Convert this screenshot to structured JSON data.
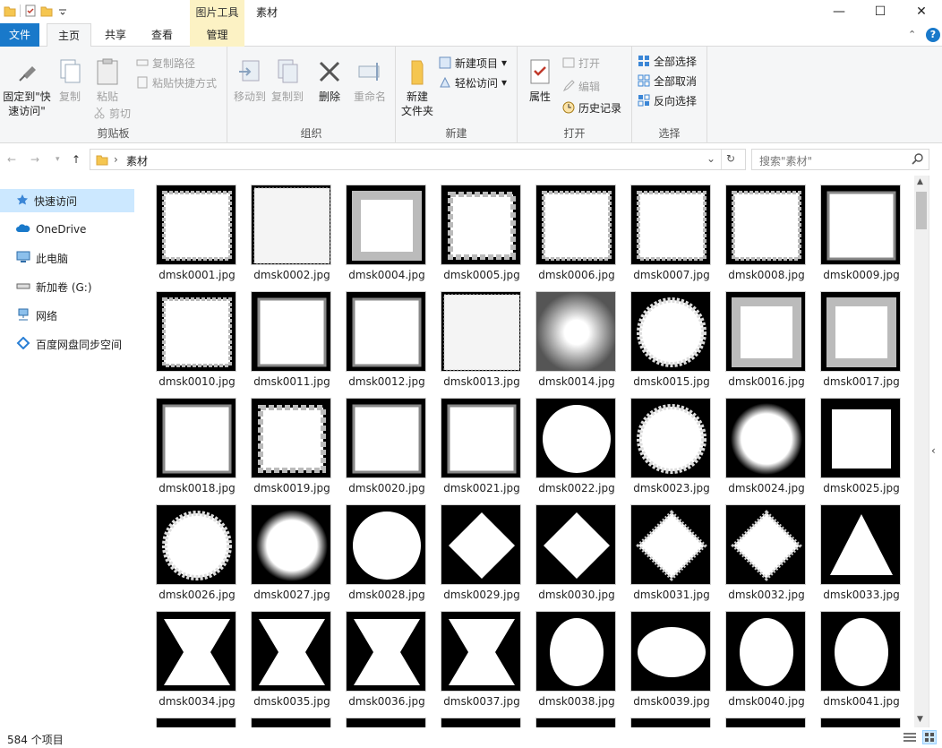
{
  "window": {
    "title": "素材",
    "context_tab_label": "图片工具",
    "controls": {
      "minimize": "—",
      "maximize": "☐",
      "close": "✕"
    }
  },
  "tabs": [
    {
      "label": "文件"
    },
    {
      "label": "主页"
    },
    {
      "label": "共享"
    },
    {
      "label": "查看"
    },
    {
      "label": "管理"
    }
  ],
  "ribbon": {
    "clipboard": {
      "label": "剪贴板",
      "pin": "固定到\"快速访问\"",
      "copy": "复制",
      "paste": "粘贴",
      "copy_path": "复制路径",
      "paste_shortcut": "粘贴快捷方式",
      "cut": "剪切"
    },
    "organize": {
      "label": "组织",
      "move_to": "移动到",
      "copy_to": "复制到",
      "delete": "删除",
      "rename": "重命名"
    },
    "new": {
      "label": "新建",
      "new_folder": "新建\n文件夹",
      "new_item": "新建项目",
      "easy_access": "轻松访问"
    },
    "open": {
      "label": "打开",
      "properties": "属性",
      "open": "打开",
      "edit": "编辑",
      "history": "历史记录"
    },
    "select": {
      "label": "选择",
      "select_all": "全部选择",
      "select_none": "全部取消",
      "invert": "反向选择"
    }
  },
  "address": {
    "path": "素材",
    "separator": "›"
  },
  "search": {
    "placeholder": "搜索\"素材\""
  },
  "sidebar": {
    "items": [
      {
        "label": "快速访问",
        "icon": "star-icon"
      },
      {
        "label": "OneDrive",
        "icon": "cloud-icon"
      },
      {
        "label": "此电脑",
        "icon": "computer-icon"
      },
      {
        "label": "新加卷 (G:)",
        "icon": "drive-icon"
      },
      {
        "label": "网络",
        "icon": "network-icon"
      },
      {
        "label": "百度网盘同步空间",
        "icon": "sync-icon"
      }
    ]
  },
  "files": [
    {
      "name": "dmsk0001.jpg",
      "shape": "square"
    },
    {
      "name": "dmsk0002.jpg",
      "shape": "square-full"
    },
    {
      "name": "dmsk0004.jpg",
      "shape": "square-frame"
    },
    {
      "name": "dmsk0005.jpg",
      "shape": "square-rough"
    },
    {
      "name": "dmsk0006.jpg",
      "shape": "square"
    },
    {
      "name": "dmsk0007.jpg",
      "shape": "square"
    },
    {
      "name": "dmsk0008.jpg",
      "shape": "square"
    },
    {
      "name": "dmsk0009.jpg",
      "shape": "square-soft"
    },
    {
      "name": "dmsk0010.jpg",
      "shape": "square"
    },
    {
      "name": "dmsk0011.jpg",
      "shape": "square-soft"
    },
    {
      "name": "dmsk0012.jpg",
      "shape": "square-soft"
    },
    {
      "name": "dmsk0013.jpg",
      "shape": "square-full"
    },
    {
      "name": "dmsk0014.jpg",
      "shape": "glow"
    },
    {
      "name": "dmsk0015.jpg",
      "shape": "circle-rough"
    },
    {
      "name": "dmsk0016.jpg",
      "shape": "square-frame"
    },
    {
      "name": "dmsk0017.jpg",
      "shape": "square-frame"
    },
    {
      "name": "dmsk0018.jpg",
      "shape": "square-soft"
    },
    {
      "name": "dmsk0019.jpg",
      "shape": "square-rough"
    },
    {
      "name": "dmsk0020.jpg",
      "shape": "square-soft"
    },
    {
      "name": "dmsk0021.jpg",
      "shape": "square-soft"
    },
    {
      "name": "dmsk0022.jpg",
      "shape": "circle"
    },
    {
      "name": "dmsk0023.jpg",
      "shape": "circle-rough"
    },
    {
      "name": "dmsk0024.jpg",
      "shape": "circle-soft"
    },
    {
      "name": "dmsk0025.jpg",
      "shape": "square-small"
    },
    {
      "name": "dmsk0026.jpg",
      "shape": "circle-rough"
    },
    {
      "name": "dmsk0027.jpg",
      "shape": "circle-soft"
    },
    {
      "name": "dmsk0028.jpg",
      "shape": "circle"
    },
    {
      "name": "dmsk0029.jpg",
      "shape": "diamond"
    },
    {
      "name": "dmsk0030.jpg",
      "shape": "diamond"
    },
    {
      "name": "dmsk0031.jpg",
      "shape": "diamond-soft"
    },
    {
      "name": "dmsk0032.jpg",
      "shape": "diamond-soft"
    },
    {
      "name": "dmsk0033.jpg",
      "shape": "triangle"
    },
    {
      "name": "dmsk0034.jpg",
      "shape": "hourglass"
    },
    {
      "name": "dmsk0035.jpg",
      "shape": "hourglass"
    },
    {
      "name": "dmsk0036.jpg",
      "shape": "hourglass"
    },
    {
      "name": "dmsk0037.jpg",
      "shape": "hourglass"
    },
    {
      "name": "dmsk0038.jpg",
      "shape": "oval-tall"
    },
    {
      "name": "dmsk0039.jpg",
      "shape": "oval-wide"
    },
    {
      "name": "dmsk0040.jpg",
      "shape": "oval-tall"
    },
    {
      "name": "dmsk0041.jpg",
      "shape": "oval-tall"
    }
  ],
  "status": {
    "count": "584 个项目"
  }
}
